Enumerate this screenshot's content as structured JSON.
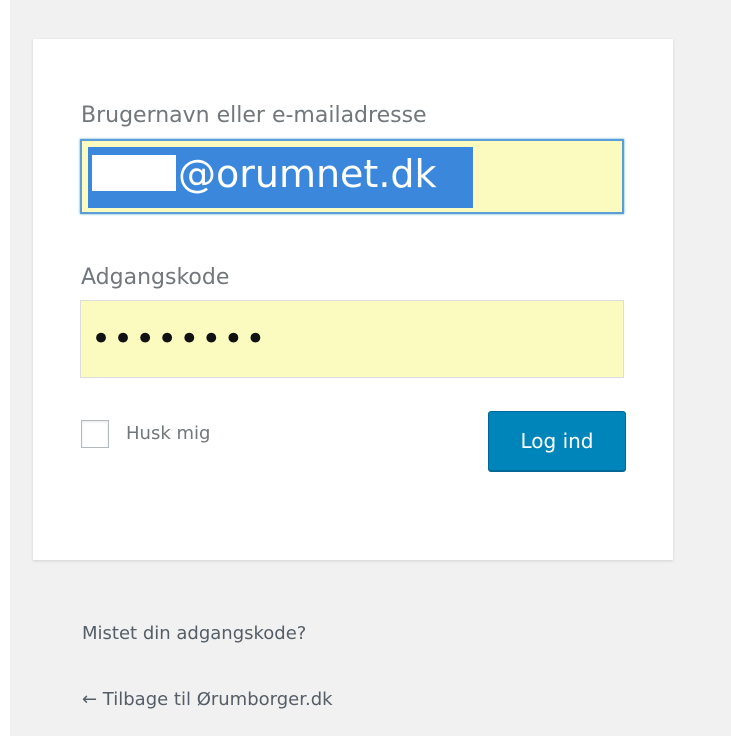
{
  "login_form": {
    "username_label": "Brugernavn eller e-mailadresse",
    "username_value": "@orumnet.dk",
    "password_label": "Adgangskode",
    "password_value": "••••••••",
    "remember_label": "Husk mig",
    "remember_checked": false,
    "submit_label": "Log ind"
  },
  "nav": {
    "lost_password": "Mistet din adgangskode?",
    "back_to_blog": "← Tilbage til Ørumborger.dk"
  },
  "colors": {
    "page_background": "#f1f1f1",
    "card_background": "#ffffff",
    "autofill_background": "#fbfbc0",
    "selection_highlight": "#3b87db",
    "focus_border": "#5b9dd9",
    "primary_button": "#0085ba",
    "label_text": "#72777c",
    "link_text": "#555d66"
  },
  "icons": {
    "back_arrow": "left-arrow-icon"
  }
}
